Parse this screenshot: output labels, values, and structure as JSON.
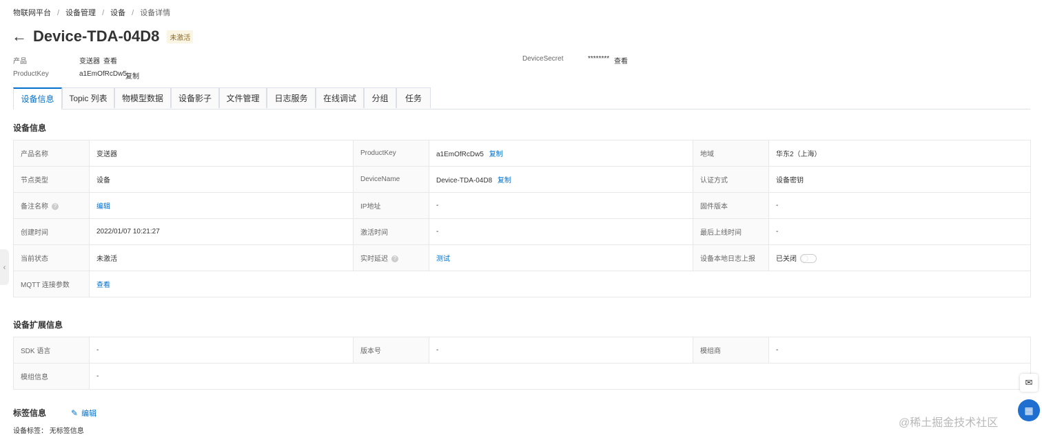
{
  "breadcrumb": [
    "物联网平台",
    "设备管理",
    "设备",
    "设备详情"
  ],
  "header": {
    "back_icon": "arrow-left-icon",
    "title": "Device-TDA-04D8",
    "status_badge": "未激活"
  },
  "summary": {
    "product_label": "产品",
    "product_value": "变送器",
    "product_link": "查看",
    "productkey_label": "ProductKey",
    "productkey_value": "a1EmOfRcDw5",
    "productkey_link": "复制",
    "secret_label": "DeviceSecret",
    "secret_value": "********",
    "secret_link": "查看"
  },
  "tabs": [
    "设备信息",
    "Topic 列表",
    "物模型数据",
    "设备影子",
    "文件管理",
    "日志服务",
    "在线调试",
    "分组",
    "任务"
  ],
  "device_info": {
    "title": "设备信息",
    "rows": [
      [
        {
          "k": "产品名称",
          "v": "变送器"
        },
        {
          "k": "ProductKey",
          "v": "a1EmOfRcDw5",
          "link": "复制"
        },
        {
          "k": "地域",
          "v": "华东2（上海）"
        }
      ],
      [
        {
          "k": "节点类型",
          "v": "设备"
        },
        {
          "k": "DeviceName",
          "v": "Device-TDA-04D8",
          "link": "复制"
        },
        {
          "k": "认证方式",
          "v": "设备密钥"
        }
      ],
      [
        {
          "k": "备注名称",
          "v": "编辑"
        },
        {
          "k": "IP地址",
          "v": "-"
        },
        {
          "k": "固件版本",
          "v": "-"
        }
      ],
      [
        {
          "k": "创建时间",
          "v": "2022/01/07 10:21:27"
        },
        {
          "k": "激活时间",
          "v": "-"
        },
        {
          "k": "最后上线时间",
          "v": "-"
        }
      ],
      [
        {
          "k": "当前状态",
          "v": "未激活"
        },
        {
          "k": "实时延迟",
          "v": "测试"
        },
        {
          "k": "设备本地日志上报",
          "v": "已关闭"
        }
      ],
      [
        {
          "k": "MQTT 连接参数",
          "v": "查看"
        }
      ]
    ]
  },
  "ext_info": {
    "title": "设备扩展信息",
    "rows": [
      [
        {
          "k": "SDK 语言",
          "v": "-"
        },
        {
          "k": "版本号",
          "v": "-"
        },
        {
          "k": "模组商",
          "v": "-"
        }
      ],
      [
        {
          "k": "模组信息",
          "v": "-"
        }
      ]
    ]
  },
  "tag_info": {
    "title": "标签信息",
    "edit_icon": "pencil-icon",
    "edit_label": "编辑",
    "tag_text": "设备标签：  无标签信息"
  },
  "floating": {
    "chat_icon": "chat-icon",
    "apps_icon": "apps-icon",
    "collapse_icon": "chevron-left-icon"
  },
  "watermark": "@稀土掘金技术社区",
  "colors": {
    "link": "#0070cc",
    "badge_bg": "#fbf5e3",
    "badge_text": "#8b6c2c",
    "apps_bg": "#1f6fd1"
  }
}
